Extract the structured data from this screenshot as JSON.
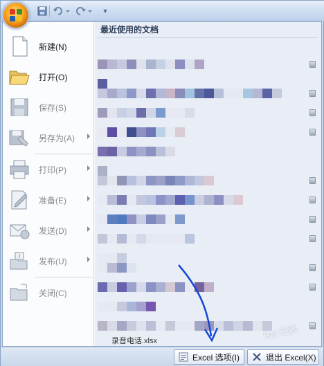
{
  "menu": {
    "items": [
      {
        "label": "新建(N)",
        "icon": "new-document-icon",
        "disabled": false,
        "submenu": false
      },
      {
        "label": "打开(O)",
        "icon": "open-folder-icon",
        "disabled": false,
        "submenu": false
      },
      {
        "label": "保存(S)",
        "icon": "save-disk-icon",
        "disabled": true,
        "submenu": false
      },
      {
        "label": "另存为(A)",
        "icon": "save-as-icon",
        "disabled": true,
        "submenu": true
      },
      {
        "label": "打印(P)",
        "icon": "printer-icon",
        "disabled": true,
        "submenu": true
      },
      {
        "label": "准备(E)",
        "icon": "prepare-icon",
        "disabled": true,
        "submenu": true
      },
      {
        "label": "发送(D)",
        "icon": "send-icon",
        "disabled": true,
        "submenu": true
      },
      {
        "label": "发布(U)",
        "icon": "publish-icon",
        "disabled": true,
        "submenu": true
      },
      {
        "label": "关闭(C)",
        "icon": "close-folder-icon",
        "disabled": true,
        "submenu": false
      }
    ]
  },
  "recent": {
    "title": "最近使用的文档",
    "last_file": "录音电话.xlsx"
  },
  "bottom": {
    "options_label": "Excel 选项(I)",
    "exit_label": "退出 Excel(X)"
  },
  "watermark": "Bai 经验",
  "colors": {
    "office_orange": "#f7a21d",
    "annotation_arrow": "#1347d6"
  }
}
